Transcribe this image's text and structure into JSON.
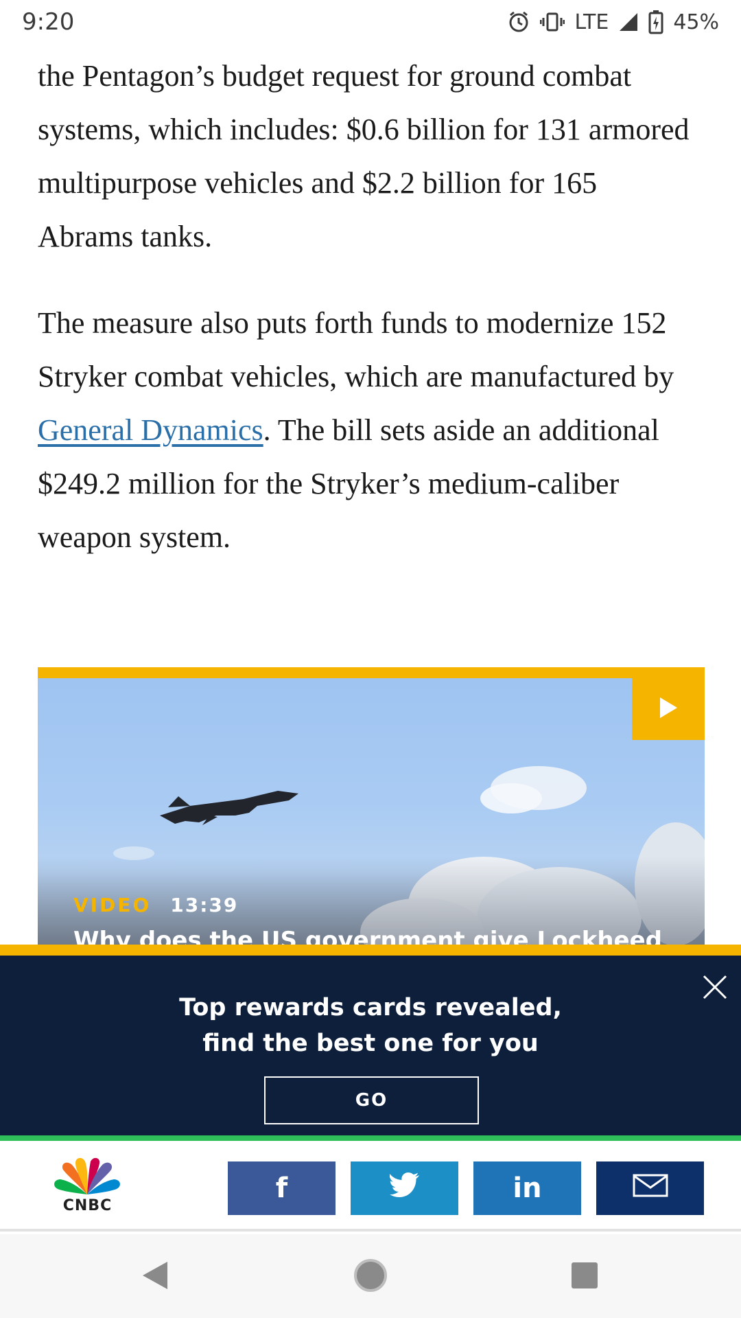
{
  "status_bar": {
    "time": "9:20",
    "network": "LTE",
    "battery": "45%",
    "icons": [
      "alarm-icon",
      "vibrate-icon",
      "signal-icon",
      "battery-charging-icon"
    ]
  },
  "article": {
    "paragraph1": "the Pentagon’s budget request for ground combat systems, which includes: $0.6 billion for 131 armored multipurpose vehicles and $2.2 billion for 165 Abrams tanks.",
    "paragraph2_before": "The measure also puts forth funds to modernize 152 Stryker combat vehicles, which are manufactured by ",
    "paragraph2_link": "General Dynamics",
    "paragraph2_after": ". The bill sets aside an additional $249.2 million for the Stryker’s medium-caliber weapon system."
  },
  "video": {
    "label": "VIDEO",
    "duration": "13:39",
    "title": "Why does the US government give Lockheed",
    "play_icon": "play-icon",
    "accent_color": "#f4b400"
  },
  "ad": {
    "headline_line1": "Top rewards cards revealed,",
    "headline_line2": "find the best one for you",
    "button_label": "GO",
    "close_icon": "close-icon",
    "background_color": "#0e1f3c"
  },
  "share_bar": {
    "logo_text": "CNBC",
    "facebook_label": "f",
    "linkedin_label": "in",
    "icons": [
      "facebook-icon",
      "twitter-icon",
      "linkedin-icon",
      "email-icon"
    ],
    "colors": {
      "facebook": "#3b5998",
      "twitter": "#1d8fc7",
      "linkedin": "#1f73b7",
      "email": "#0d2f6a"
    }
  },
  "nav_bar": {
    "icons": [
      "back-icon",
      "home-icon",
      "recents-icon"
    ]
  }
}
